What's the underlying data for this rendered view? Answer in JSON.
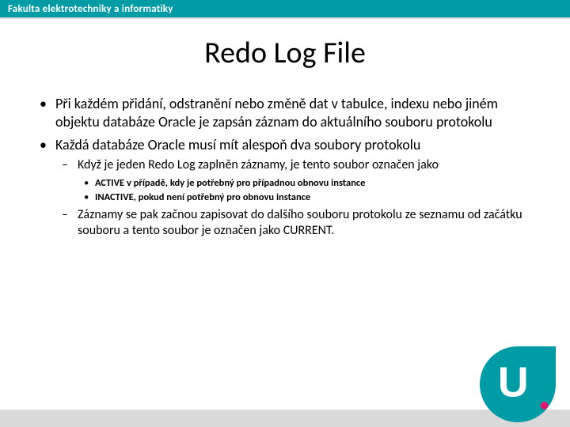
{
  "header": {
    "faculty": "Fakulta elektrotechniky a informatiky"
  },
  "title": "Redo Log File",
  "bullets": {
    "b1": "Při každém přidání, odstranění nebo změně dat v tabulce, indexu nebo jiném objektu databáze Oracle je zapsán záznam do aktuálního souboru protokolu",
    "b2": "Každá databáze Oracle musí mít alespoň dva soubory protokolu",
    "b2_1": "Když je jeden Redo Log zaplněn záznamy, je tento soubor označen jako",
    "b2_1_a": "ACTIVE v případě, kdy je potřebný pro případnou obnovu instance",
    "b2_1_b": "INACTIVE, pokud není potřebný pro obnovu instance",
    "b2_2": "Záznamy se pak začnou zapisovat do dalšího souboru protokolu ze seznamu od začátku souboru a tento soubor je označen jako CURRENT."
  },
  "logo": {
    "letter": "U",
    "dot_color": "#e41571",
    "main_color": "#009ca6"
  },
  "colors": {
    "accent": "#009ca6",
    "footer": "#d9d9d9"
  }
}
